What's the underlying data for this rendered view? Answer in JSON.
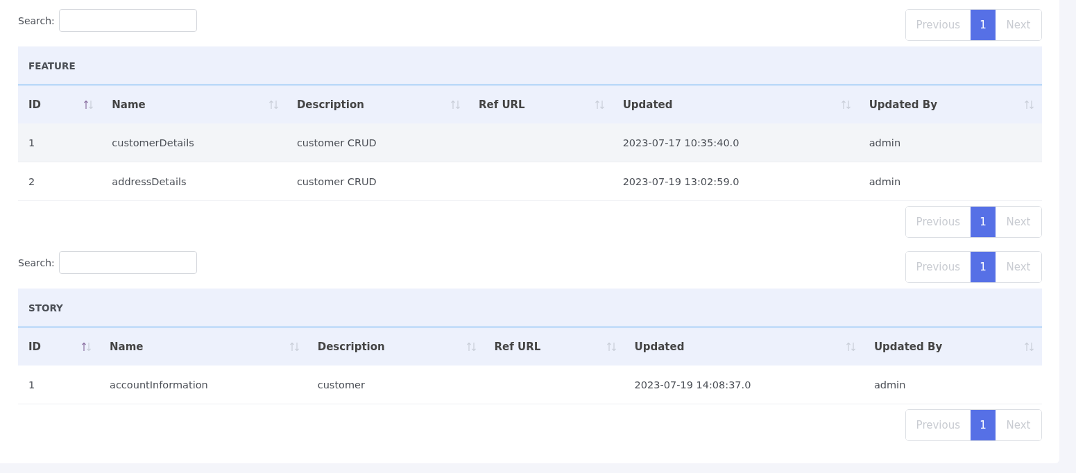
{
  "sections": [
    {
      "search": {
        "label": "Search:"
      },
      "pager_top": [
        {
          "label": "Previous",
          "kind": "prev",
          "selected": false,
          "disabled": true
        },
        {
          "label": "1",
          "kind": "page",
          "selected": true,
          "disabled": false
        },
        {
          "label": "Next",
          "kind": "next",
          "selected": false,
          "disabled": true
        }
      ],
      "table": {
        "title": "FEATURE",
        "columns": [
          {
            "label": "ID",
            "sorted": true
          },
          {
            "label": "Name",
            "sorted": false
          },
          {
            "label": "Description",
            "sorted": false
          },
          {
            "label": "Ref URL",
            "sorted": false
          },
          {
            "label": "Updated",
            "sorted": false
          },
          {
            "label": "Updated By",
            "sorted": false
          }
        ],
        "rows": [
          {
            "highlighted": true,
            "cells": [
              "1",
              "customerDetails",
              "customer CRUD",
              "",
              "2023-07-17 10:35:40.0",
              "admin"
            ]
          },
          {
            "highlighted": false,
            "cells": [
              "2",
              "addressDetails",
              "customer CRUD",
              "",
              "2023-07-19 13:02:59.0",
              "admin"
            ]
          }
        ]
      },
      "pager_bottom": [
        {
          "label": "Previous",
          "kind": "prev",
          "selected": false,
          "disabled": true
        },
        {
          "label": "1",
          "kind": "page",
          "selected": true,
          "disabled": false
        },
        {
          "label": "Next",
          "kind": "next",
          "selected": false,
          "disabled": true
        }
      ]
    },
    {
      "search": {
        "label": "Search:"
      },
      "pager_top": [
        {
          "label": "Previous",
          "kind": "prev",
          "selected": false,
          "disabled": true
        },
        {
          "label": "1",
          "kind": "page",
          "selected": true,
          "disabled": false
        },
        {
          "label": "Next",
          "kind": "next",
          "selected": false,
          "disabled": true
        }
      ],
      "table": {
        "title": "STORY",
        "columns": [
          {
            "label": "ID",
            "sorted": true
          },
          {
            "label": "Name",
            "sorted": false
          },
          {
            "label": "Description",
            "sorted": false
          },
          {
            "label": "Ref URL",
            "sorted": false
          },
          {
            "label": "Updated",
            "sorted": false
          },
          {
            "label": "Updated By",
            "sorted": false
          }
        ],
        "rows": [
          {
            "highlighted": false,
            "cells": [
              "1",
              "accountInformation",
              "customer",
              "",
              "2023-07-19 14:08:37.0",
              "admin"
            ]
          }
        ]
      },
      "pager_bottom": [
        {
          "label": "Previous",
          "kind": "prev",
          "selected": false,
          "disabled": true
        },
        {
          "label": "1",
          "kind": "page",
          "selected": true,
          "disabled": false
        },
        {
          "label": "Next",
          "kind": "next",
          "selected": false,
          "disabled": true
        }
      ]
    }
  ]
}
